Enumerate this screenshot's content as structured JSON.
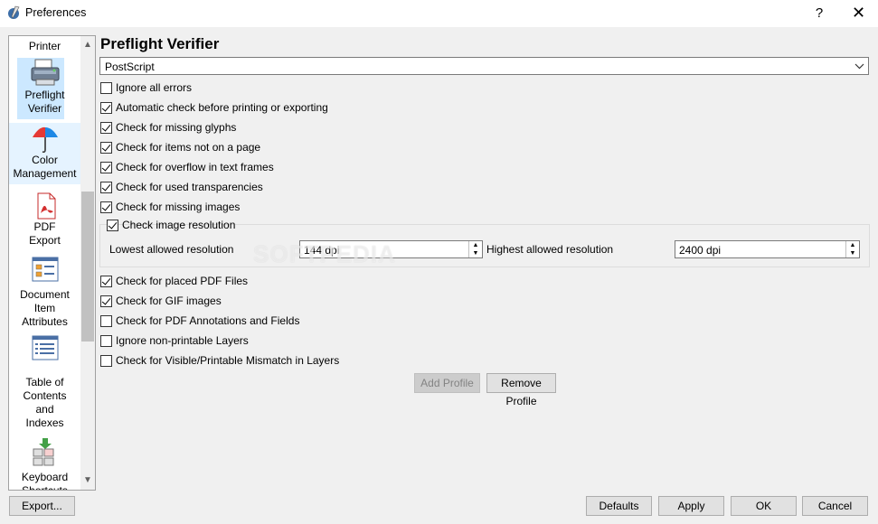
{
  "window": {
    "title": "Preferences",
    "help_label": "?",
    "close_label": "✕"
  },
  "sidebar": {
    "items": [
      {
        "label": "Printer",
        "icon": "printer-icon"
      },
      {
        "label": "Preflight\nVerifier",
        "icon": "preflight-printer-icon"
      },
      {
        "label": "Color\nManagement",
        "icon": "color-umbrella-icon"
      },
      {
        "label": "PDF\nExport",
        "icon": "pdf-icon"
      },
      {
        "label": "Document\nItem\nAttributes",
        "icon": "attributes-icon"
      },
      {
        "label": "Table of\nContents\nand\nIndexes",
        "icon": "toc-icon"
      },
      {
        "label": "Keyboard\nShortcuts",
        "icon": "keyboard-icon"
      }
    ],
    "selected": "Preflight Verifier"
  },
  "main": {
    "heading": "Preflight Verifier",
    "profile": "PostScript",
    "checks": [
      {
        "label": "Ignore all errors",
        "checked": false
      },
      {
        "label": "Automatic check before printing or exporting",
        "checked": true
      },
      {
        "label": "Check for missing glyphs",
        "checked": true
      },
      {
        "label": "Check for items not on a page",
        "checked": true
      },
      {
        "label": "Check for overflow in text frames",
        "checked": true
      },
      {
        "label": "Check for used transparencies",
        "checked": true
      },
      {
        "label": "Check for missing images",
        "checked": true
      }
    ],
    "image_resolution": {
      "label": "Check image resolution",
      "checked": true,
      "lowest_label": "Lowest allowed resolution",
      "lowest_value": "144 dpi",
      "highest_label": "Highest allowed resolution",
      "highest_value": "2400 dpi"
    },
    "checks2": [
      {
        "label": "Check for placed PDF Files",
        "checked": true
      },
      {
        "label": "Check for GIF images",
        "checked": true
      },
      {
        "label": "Check for PDF Annotations and Fields",
        "checked": false
      },
      {
        "label": "Ignore non-printable Layers",
        "checked": false
      },
      {
        "label": "Check for Visible/Printable Mismatch in Layers",
        "checked": false
      }
    ],
    "add_profile": "Add Profile",
    "remove_profile": "Remove Profile"
  },
  "footer": {
    "export": "Export...",
    "defaults": "Defaults",
    "apply": "Apply",
    "ok": "OK",
    "cancel": "Cancel"
  },
  "watermark": "SOFTPEDIA"
}
